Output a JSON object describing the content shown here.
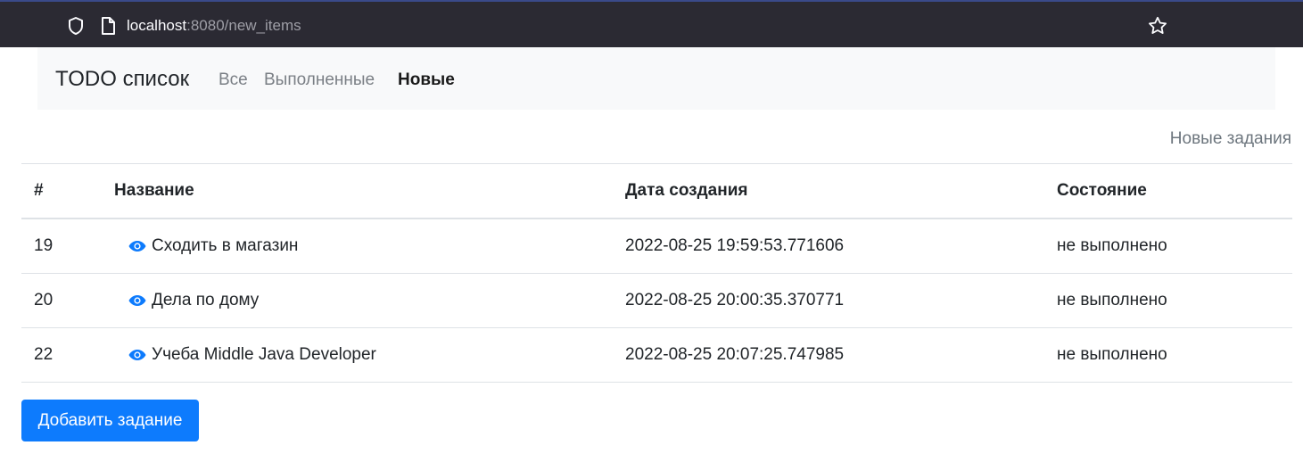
{
  "browser": {
    "url_host": "localhost",
    "url_rest": ":8080/new_items"
  },
  "navbar": {
    "brand": "TODO список",
    "links": [
      {
        "label": "Все",
        "active": false
      },
      {
        "label": "Выполненные",
        "active": false
      },
      {
        "label": "Новые",
        "active": true
      }
    ]
  },
  "caption": "Новые задания",
  "table": {
    "headers": {
      "num": "#",
      "name": "Название",
      "date": "Дата создания",
      "state": "Состояние"
    },
    "rows": [
      {
        "num": "19",
        "name": "Сходить в магазин",
        "date": "2022-08-25 19:59:53.771606",
        "state": "не выполнено",
        "icon": "eye-icon"
      },
      {
        "num": "20",
        "name": "Дела по дому",
        "date": "2022-08-25 20:00:35.370771",
        "state": "не выполнено",
        "icon": "eye-icon"
      },
      {
        "num": "22",
        "name": "Учеба Middle Java Developer",
        "date": "2022-08-25 20:07:25.747985",
        "state": "не выполнено",
        "icon": "eye-icon"
      }
    ]
  },
  "add_button": "Добавить задание",
  "colors": {
    "accent": "#0d7bfd",
    "browser_bar": "#2b2a33",
    "navbar_bg": "#f8f9fa"
  }
}
